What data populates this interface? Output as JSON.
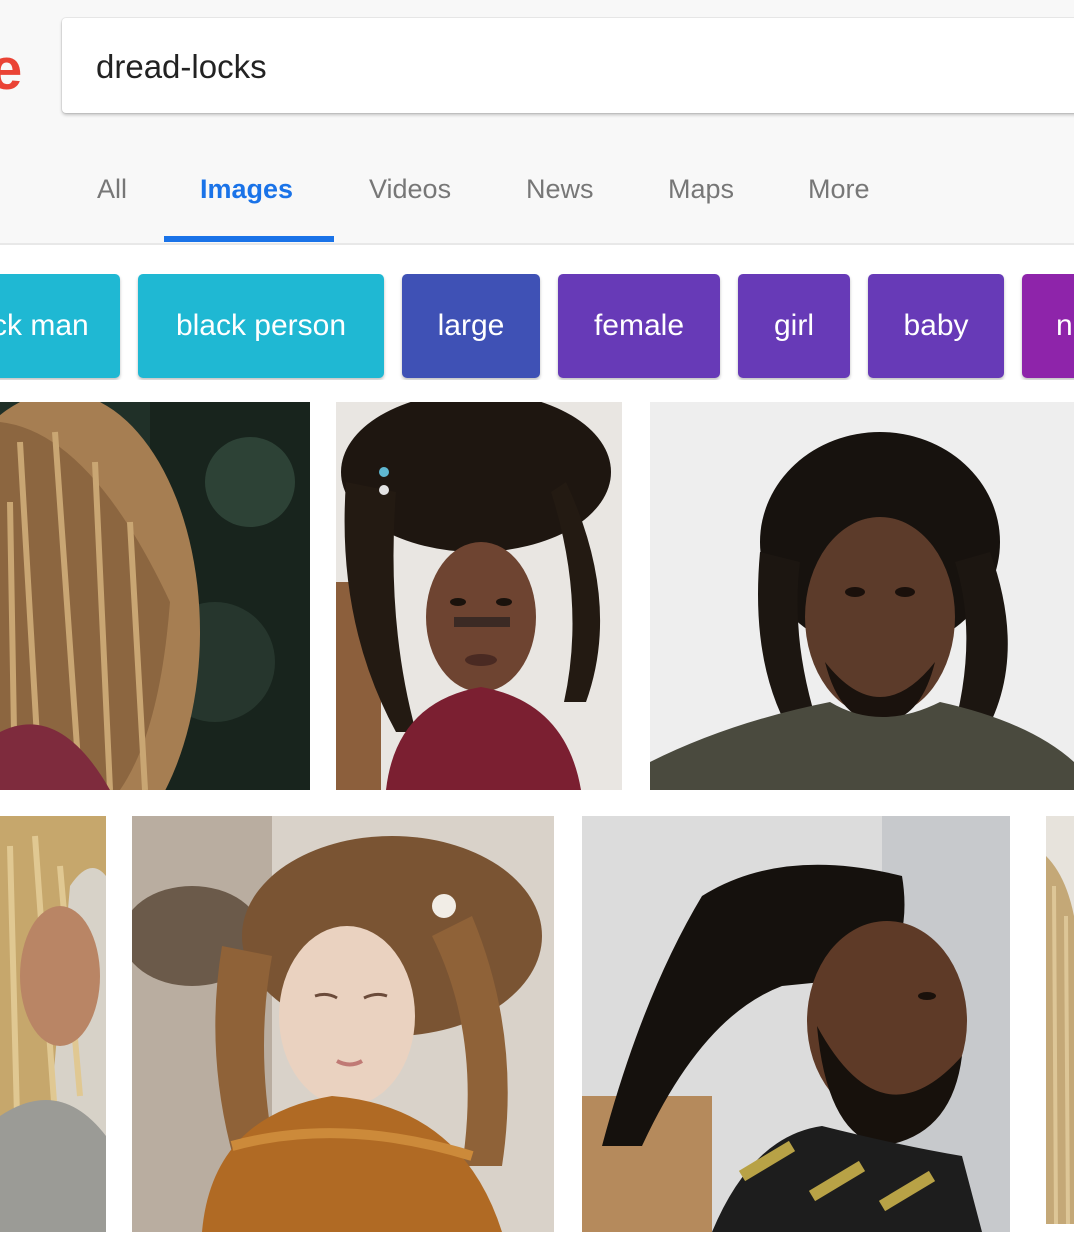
{
  "search": {
    "query": "dread-locks"
  },
  "logo": {
    "visible_fragment": "e"
  },
  "tabs": [
    {
      "label": "All"
    },
    {
      "label": "Images"
    },
    {
      "label": "Videos"
    },
    {
      "label": "News"
    },
    {
      "label": "Maps"
    },
    {
      "label": "More"
    }
  ],
  "active_tab": "Images",
  "chips": [
    {
      "label": "ck man",
      "color": "#1fb8d3"
    },
    {
      "label": "black person",
      "color": "#1fb8d3"
    },
    {
      "label": "large",
      "color": "#3f51b5"
    },
    {
      "label": "female",
      "color": "#673ab7"
    },
    {
      "label": "girl",
      "color": "#673ab7"
    },
    {
      "label": "baby",
      "color": "#673ab7"
    },
    {
      "label": "n",
      "color": "#8e24aa"
    }
  ],
  "colors": {
    "accent": "#1a73e8",
    "logo_red": "#ea4335"
  },
  "results": [
    {
      "kind": "image"
    },
    {
      "kind": "image"
    },
    {
      "kind": "image"
    },
    {
      "kind": "image"
    },
    {
      "kind": "image"
    },
    {
      "kind": "image"
    },
    {
      "kind": "image"
    }
  ]
}
